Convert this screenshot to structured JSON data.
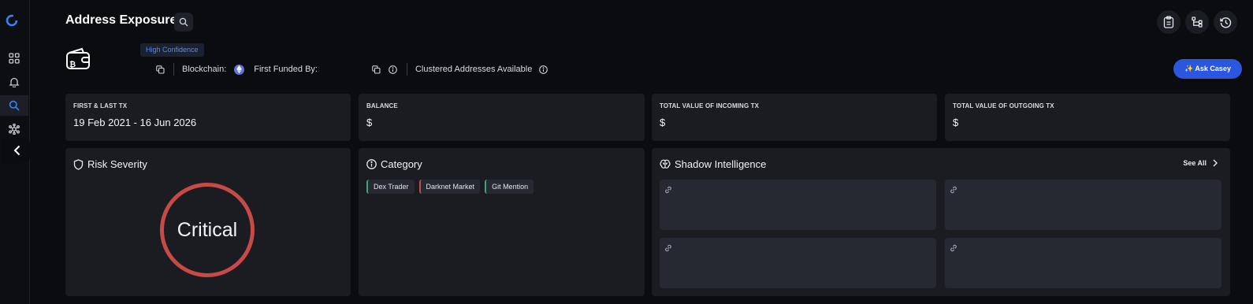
{
  "header": {
    "title": "Address Exposure"
  },
  "address": {
    "confidence": "High Confidence",
    "blockchain_label": "Blockchain:",
    "first_funded_label": "First Funded By:",
    "clustered_label": "Clustered Addresses Available"
  },
  "actions": {
    "ask_label": "✨ Ask Casey"
  },
  "stats": [
    {
      "label": "FIRST & LAST TX",
      "value": "19 Feb 2021 - 16 Jun 2026"
    },
    {
      "label": "BALANCE",
      "value": "$"
    },
    {
      "label": "TOTAL VALUE OF INCOMING TX",
      "value": "$"
    },
    {
      "label": "TOTAL VALUE OF OUTGOING TX",
      "value": "$"
    }
  ],
  "risk": {
    "title": "Risk Severity",
    "level": "Critical",
    "color": "#c64a45"
  },
  "category": {
    "title": "Category",
    "tags": [
      {
        "label": "Dex Trader",
        "color": "#3ca37a"
      },
      {
        "label": "Darknet Market",
        "color": "#c64a45"
      },
      {
        "label": "Git Mention",
        "color": "#3ca37a"
      }
    ]
  },
  "intel": {
    "title": "Shadow Intelligence",
    "see_all": "See All"
  },
  "colors": {
    "accent": "#2a56e0",
    "background": "#0b0c0f",
    "card": "#1a1c22"
  }
}
